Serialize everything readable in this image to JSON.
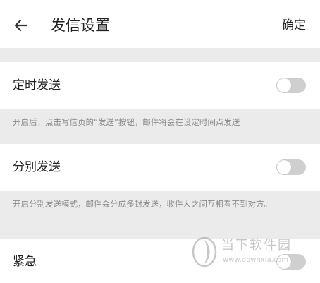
{
  "header": {
    "title": "发信设置",
    "confirm_label": "确定"
  },
  "settings": [
    {
      "label": "定时发送",
      "enabled": false,
      "description": "开启后，点击写信页的“发送”按钮，邮件将会在设定时间点发送"
    },
    {
      "label": "分别发送",
      "enabled": false,
      "description": "开启分别发送模式，邮件会分成多封发送，收件人之间互相看不到对方。"
    },
    {
      "label": "紧急",
      "enabled": false
    }
  ],
  "watermark": {
    "name": "当下软件园",
    "url": "www.downxia.com"
  },
  "colors": {
    "page_background": "#ffffff",
    "section_gap": "#ebebeb",
    "toggle_off": "#cfcfcf",
    "description_text": "#8a8a8a"
  },
  "icons": {
    "back": "back-arrow-icon",
    "watermark_logo": "watermark-logo-icon"
  }
}
